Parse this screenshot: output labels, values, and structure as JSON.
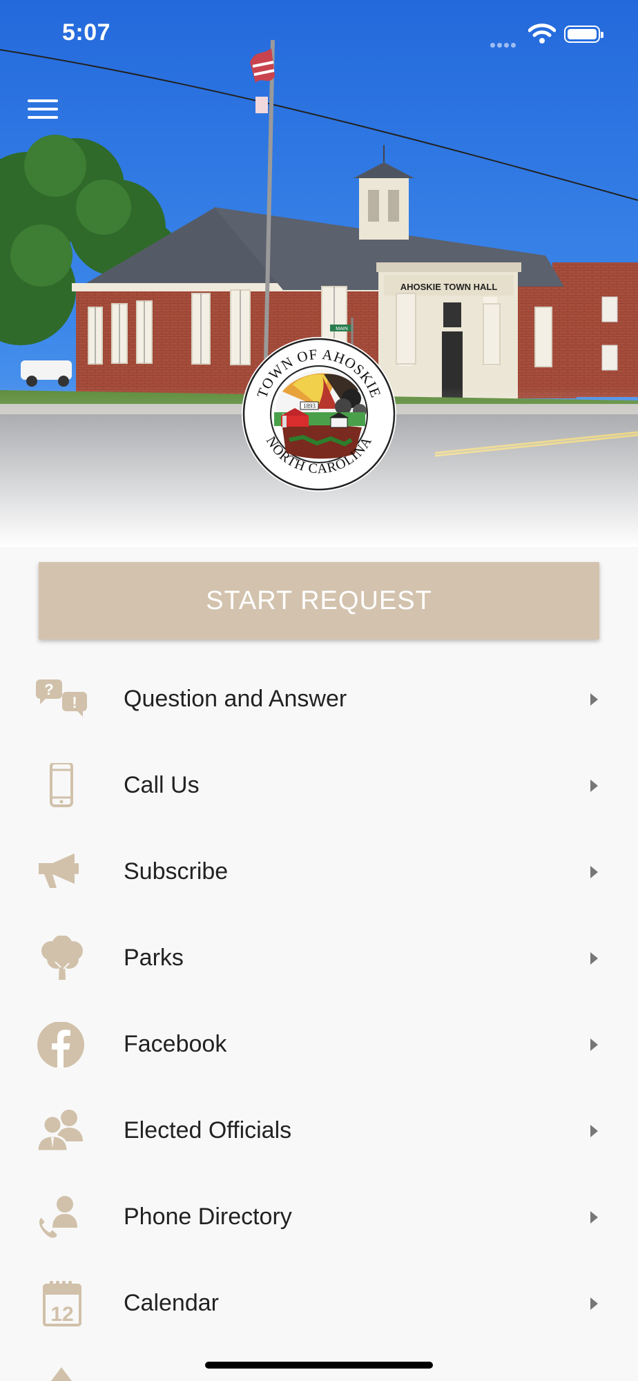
{
  "status_bar": {
    "time": "5:07"
  },
  "header": {
    "menu_icon": "hamburger-icon",
    "building_sign": "AHOSKIE TOWN HALL",
    "street_sign": "MAIN"
  },
  "seal": {
    "top_text": "TOWN OF AHOSKIE",
    "bottom_text": "NORTH CAROLINA",
    "year": "1893"
  },
  "start_button": {
    "label": "START REQUEST"
  },
  "menu": {
    "items": [
      {
        "label": "Question and Answer",
        "icon": "question-bubbles-icon"
      },
      {
        "label": "Call Us",
        "icon": "phone-icon"
      },
      {
        "label": "Subscribe",
        "icon": "megaphone-icon"
      },
      {
        "label": "Parks",
        "icon": "tree-icon"
      },
      {
        "label": "Facebook",
        "icon": "facebook-icon"
      },
      {
        "label": "Elected Officials",
        "icon": "officials-icon"
      },
      {
        "label": "Phone Directory",
        "icon": "phone-directory-icon"
      },
      {
        "label": "Calendar",
        "icon": "calendar-icon",
        "day": "12"
      }
    ]
  },
  "colors": {
    "accent": "#d3c3ae",
    "icon": "#d1c1aa",
    "sky": "#2f7be6",
    "background": "#f8f8f8"
  }
}
